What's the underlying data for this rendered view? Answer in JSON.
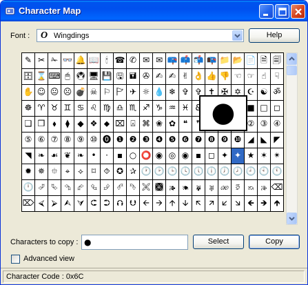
{
  "window": {
    "title": "Character Map"
  },
  "font_row": {
    "label": "Font :",
    "selected": "Wingdings",
    "help_label": "Help"
  },
  "grid": {
    "columns": 20,
    "selected_index": 136,
    "chars": [
      "✎",
      "✂",
      "✁",
      "👓",
      "🔔",
      "📖",
      "🕯",
      "☎",
      "✆",
      "✉",
      "✉",
      "📪",
      "📫",
      "📬",
      "📭",
      "📁",
      "📂",
      "📄",
      "🗎",
      "🗐",
      "🗄",
      "⌛",
      "⌨",
      "🖱",
      "🖲",
      "🖥",
      "💾",
      "🖫",
      "🖬",
      "✇",
      "✍",
      "✍",
      "✌",
      "👌",
      "👍",
      "👎",
      "☜",
      "☞",
      "☝",
      "☟",
      "✋",
      "☺",
      "😐",
      "☹",
      "💣",
      "☠",
      "⚐",
      "🏱",
      "✈",
      "☼",
      "💧",
      "❄",
      "✞",
      "✞",
      "✝",
      "✠",
      "✡",
      "☪",
      "☯",
      "ॐ",
      "☸",
      "♈",
      "♉",
      "♊",
      "♋",
      "♌",
      "♍",
      "♎",
      "♏",
      "♐",
      "♑",
      "♒",
      "♓",
      "&",
      "&",
      "●",
      "❍",
      "■",
      "□",
      "◻",
      "❑",
      "❒",
      "⬧",
      "⧫",
      "◆",
      "❖",
      "⬥",
      "⌧",
      "⍓",
      "⌘",
      "❀",
      "✿",
      "❝",
      "❞",
      "▯",
      "⓪",
      "①",
      "②",
      "③",
      "④",
      "⑤",
      "⑥",
      "⑦",
      "⑧",
      "⑨",
      "⑩",
      "⓿",
      "❶",
      "❷",
      "❸",
      "❹",
      "❺",
      "❻",
      "❼",
      "❽",
      "❾",
      "❿",
      "◢",
      "◣",
      "◤",
      "◥",
      "❧",
      "☙",
      "❦",
      "❧",
      "•",
      "·",
      "▪",
      "○",
      "⭕",
      "◉",
      "◎",
      "◉",
      "▪",
      "◻",
      "✦",
      "✦",
      "★",
      "✶",
      "✴",
      "✹",
      "✵",
      "⯐",
      "⌖",
      "⟡",
      "⌑",
      "⯑",
      "✪",
      "✰",
      "🕐",
      "🕑",
      "🕒",
      "🕓",
      "🕔",
      "🕕",
      "🕖",
      "🕗",
      "🕘",
      "🕙",
      "🕚",
      "🕛",
      "⮰",
      "⮱",
      "⮲",
      "⮳",
      "⮴",
      "⮵",
      "⮶",
      "⮷",
      "🙪",
      "🙫",
      "🙕",
      "🙔",
      "🙗",
      "🙖",
      "🙐",
      "🙑",
      "🙒",
      "🙓",
      "⌫",
      "⌦",
      "⮘",
      "⮚",
      "⮙",
      "⮛",
      "⮈",
      "⮊",
      "⮉",
      "⮋",
      "🡨",
      "🡪",
      "🡩",
      "🡫",
      "🡬",
      "🡭",
      "🡯",
      "🡮",
      "🡸",
      "🡺",
      "🡹"
    ]
  },
  "zoom": {
    "char": "●"
  },
  "copy_row": {
    "label": "Characters to copy :",
    "value": "●",
    "select_label": "Select",
    "copy_label": "Copy"
  },
  "advanced": {
    "label": "Advanced view",
    "checked": false
  },
  "status": {
    "text": "Character Code : 0x6C"
  },
  "colors": {
    "title_bar": "#0054e3",
    "window_bg": "#ece9d8",
    "selected_cell": "#316ac5"
  }
}
